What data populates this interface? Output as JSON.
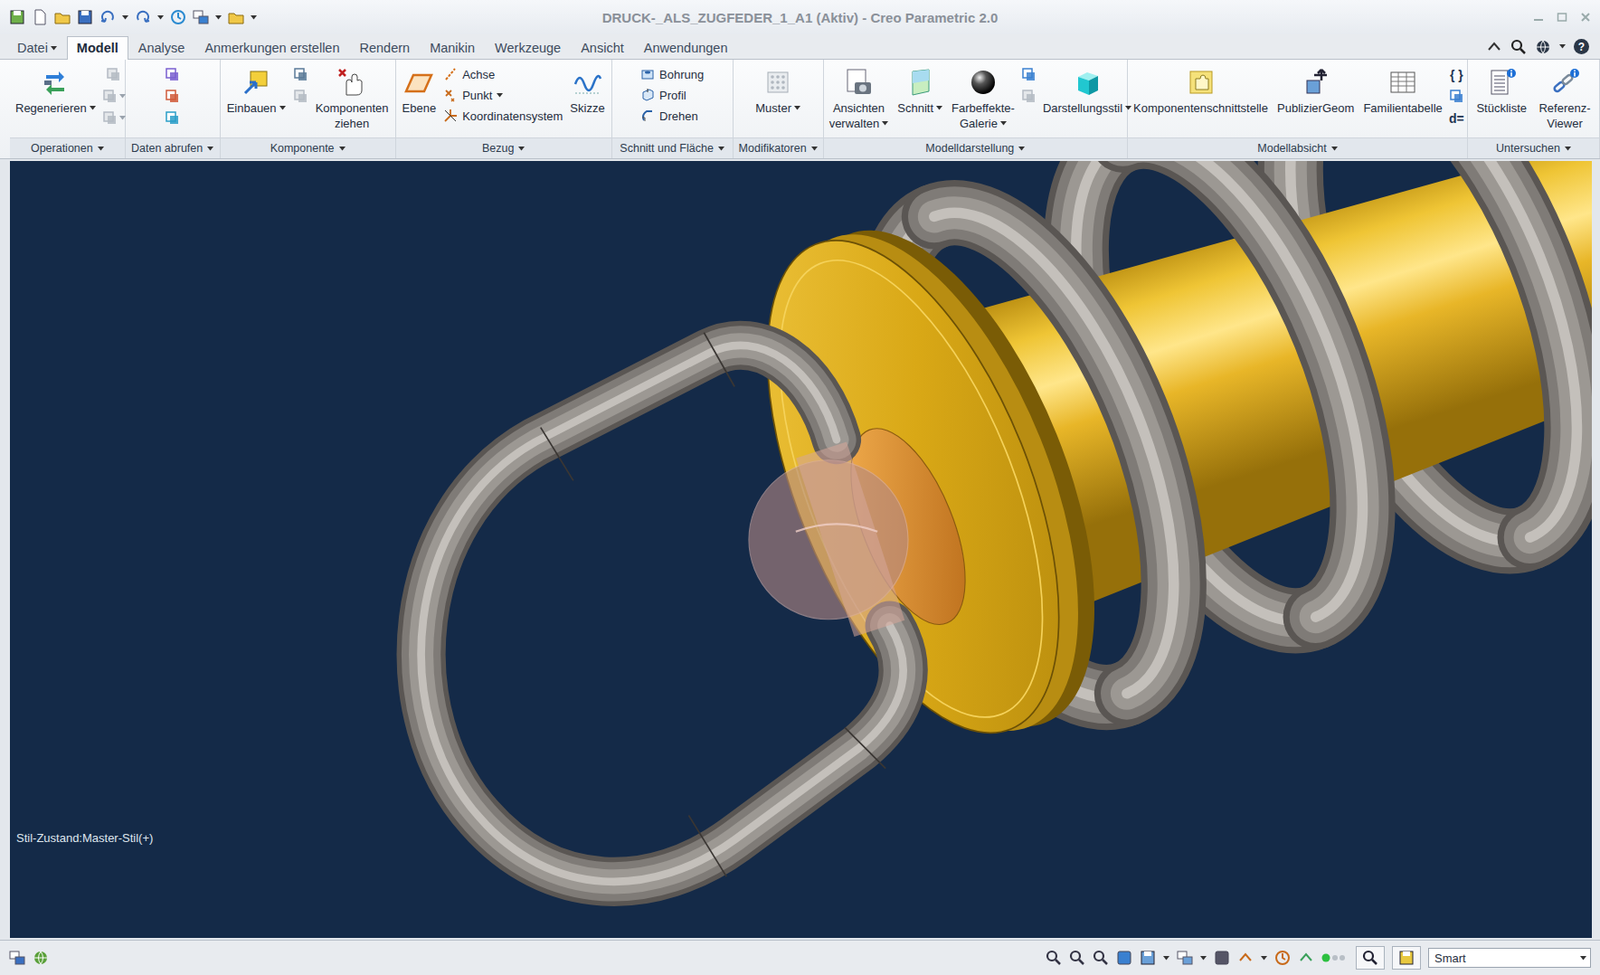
{
  "window": {
    "title": "DRUCK-_ALS_ZUGFEDER_1_A1 (Aktiv) - Creo Parametric 2.0"
  },
  "tabs": [
    {
      "label": "Datei",
      "selected": false,
      "dropdown": true
    },
    {
      "label": "Modell",
      "selected": true,
      "dropdown": false
    },
    {
      "label": "Analyse",
      "selected": false,
      "dropdown": false
    },
    {
      "label": "Anmerkungen erstellen",
      "selected": false,
      "dropdown": false
    },
    {
      "label": "Rendern",
      "selected": false,
      "dropdown": false
    },
    {
      "label": "Manikin",
      "selected": false,
      "dropdown": false
    },
    {
      "label": "Werkzeuge",
      "selected": false,
      "dropdown": false
    },
    {
      "label": "Ansicht",
      "selected": false,
      "dropdown": false
    },
    {
      "label": "Anwendungen",
      "selected": false,
      "dropdown": false
    }
  ],
  "tab_bar_tools": {
    "help": "?"
  },
  "ribbon_groups": [
    {
      "label": "Operationen",
      "dropdown": true,
      "items": [
        {
          "kind": "large",
          "lines": [
            "Regenerieren"
          ],
          "dropdown": true
        },
        {
          "kind": "icons",
          "rows": [
            {
              "disabled": true,
              "dropdown": false
            },
            {
              "disabled": true,
              "dropdown": true
            },
            {
              "disabled": true,
              "dropdown": true
            }
          ]
        }
      ]
    },
    {
      "label": "Daten abrufen",
      "dropdown": true,
      "items": [
        {
          "kind": "icons",
          "rows": [
            {
              "disabled": false,
              "dropdown": false
            },
            {
              "disabled": false,
              "dropdown": false
            },
            {
              "disabled": false,
              "dropdown": false
            }
          ]
        }
      ]
    },
    {
      "label": "Komponente",
      "dropdown": true,
      "items": [
        {
          "kind": "large",
          "lines": [
            "Einbauen"
          ],
          "dropdown": true
        },
        {
          "kind": "icons",
          "rows": [
            {
              "disabled": false,
              "dropdown": false
            },
            {
              "disabled": true,
              "dropdown": false
            }
          ]
        },
        {
          "kind": "large",
          "lines": [
            "Komponenten",
            "ziehen"
          ],
          "dropdown": false
        }
      ]
    },
    {
      "label": "Bezug",
      "dropdown": true,
      "items": [
        {
          "kind": "large",
          "lines": [
            "Ebene"
          ],
          "dropdown": false
        },
        {
          "kind": "list",
          "rows": [
            {
              "label": "Achse",
              "dropdown": false
            },
            {
              "label": "Punkt",
              "dropdown": true
            },
            {
              "label": "Koordinatensystem",
              "dropdown": false
            }
          ]
        },
        {
          "kind": "large",
          "lines": [
            "Skizze"
          ],
          "dropdown": false
        }
      ]
    },
    {
      "label": "Schnitt und Fläche",
      "dropdown": true,
      "items": [
        {
          "kind": "list",
          "rows": [
            {
              "label": "Bohrung",
              "dropdown": false
            },
            {
              "label": "Profil",
              "dropdown": false
            },
            {
              "label": "Drehen",
              "dropdown": false
            }
          ]
        }
      ]
    },
    {
      "label": "Modifikatoren",
      "dropdown": true,
      "items": [
        {
          "kind": "large",
          "lines": [
            "Muster"
          ],
          "dropdown": true
        }
      ]
    },
    {
      "label": "Modelldarstellung",
      "dropdown": true,
      "items": [
        {
          "kind": "large",
          "lines": [
            "Ansichten",
            "verwalten"
          ],
          "dropdown": true
        },
        {
          "kind": "large",
          "lines": [
            "Schnitt"
          ],
          "dropdown": true
        },
        {
          "kind": "large",
          "lines": [
            "Farbeffekte-",
            "Galerie"
          ],
          "dropdown": true
        },
        {
          "kind": "icons",
          "rows": [
            {
              "disabled": false,
              "dropdown": false
            },
            {
              "disabled": true,
              "dropdown": false
            }
          ]
        },
        {
          "kind": "large",
          "lines": [
            "Darstellungsstil"
          ],
          "dropdown": true
        }
      ]
    },
    {
      "label": "Modellabsicht",
      "dropdown": true,
      "items": [
        {
          "kind": "large",
          "lines": [
            "Komponentenschnittstelle"
          ],
          "dropdown": false
        },
        {
          "kind": "large",
          "lines": [
            "PublizierGeom"
          ],
          "dropdown": false
        },
        {
          "kind": "large",
          "lines": [
            "Familientabelle"
          ],
          "dropdown": false
        },
        {
          "kind": "icons",
          "rows": [
            {
              "disabled": false,
              "dropdown": false,
              "glyph": "{ }"
            },
            {
              "disabled": false,
              "dropdown": false
            },
            {
              "disabled": false,
              "dropdown": false,
              "glyph": "d="
            }
          ]
        }
      ]
    },
    {
      "label": "Untersuchen",
      "dropdown": true,
      "items": [
        {
          "kind": "large",
          "lines": [
            "Stückliste"
          ],
          "dropdown": false
        },
        {
          "kind": "large",
          "lines": [
            "Referenz-",
            "Viewer"
          ],
          "dropdown": false
        }
      ]
    }
  ],
  "viewport": {
    "style_state": "Stil-Zustand:Master-Stil(+)"
  },
  "status_bar": {
    "filter": "Smart"
  }
}
